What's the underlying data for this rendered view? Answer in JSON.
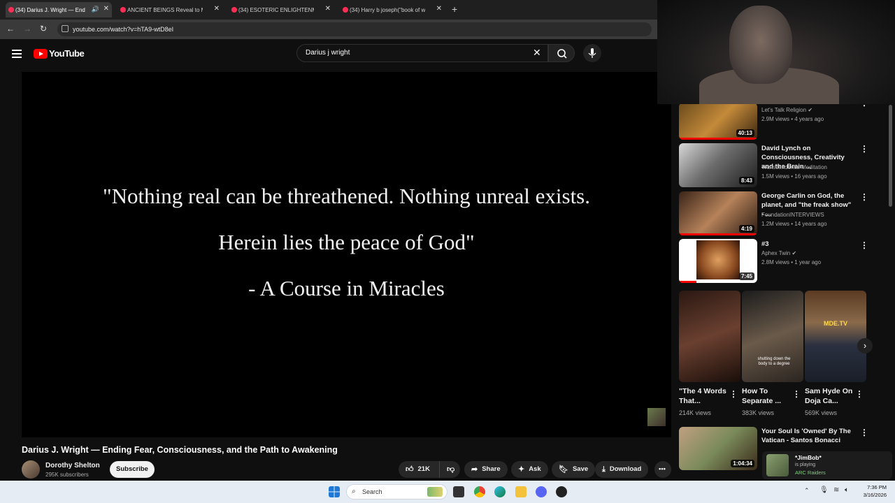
{
  "browser": {
    "tabs": [
      {
        "label": "(34) Darius J. Wright — End",
        "active": true,
        "audio": true
      },
      {
        "label": "ANCIENT BEINGS Reveal to Ma",
        "active": false
      },
      {
        "label": "(34) ESOTERIC ENLIGHTENMEN",
        "active": false
      },
      {
        "label": "(34) Harry b joseph(\"book of wi",
        "active": false
      }
    ],
    "new_tab": "+",
    "url": "youtube.com/watch?v=hTA9-wtD8eI"
  },
  "youtube": {
    "logo_text": "YouTube",
    "search_value": "Darius j wright"
  },
  "video": {
    "quote_lines": [
      "\"Nothing real can be threathened. Nothing unreal exists.",
      "Herein lies the peace of God\"",
      "- A Course in Miracles"
    ],
    "title": "Darius J. Wright — Ending Fear, Consciousness, and the Path to Awakening",
    "channel": "Dorothy Shelton",
    "subscribers": "295K subscribers",
    "subscribe_label": "Subscribe",
    "likes": "21K",
    "share_label": "Share",
    "ask_label": "Ask",
    "save_label": "Save",
    "download_label": "Download"
  },
  "sidebar": {
    "videos": [
      {
        "title": "",
        "channel": "Let's Talk Religion",
        "verified": true,
        "meta": "2.9M views • 4 years ago",
        "duration": "40:13"
      },
      {
        "title": "David Lynch on Consciousness, Creativity and the Brain ...",
        "channel": "Transcendental Meditation",
        "verified": false,
        "meta": "1.5M views • 16 years ago",
        "duration": "8:43"
      },
      {
        "title": "George Carlin on God, the planet, and \"the freak show\" - ...",
        "channel": "FoundationINTERVIEWS",
        "verified": false,
        "meta": "1.2M views • 14 years ago",
        "duration": "4:19"
      },
      {
        "title": "#3",
        "channel": "Aphex Twin",
        "verified": true,
        "meta": "2.8M views • 1 year ago",
        "duration": "7:45"
      },
      {
        "title": "Your Soul Is 'Owned' By The Vatican - Santos Bonacci",
        "channel": "",
        "verified": false,
        "meta": "",
        "duration": "1:04:34"
      }
    ],
    "shorts": [
      {
        "title": "\"The 4 Words That...",
        "views": "214K views",
        "overlay": ""
      },
      {
        "title": "How To Separate ...",
        "views": "383K views",
        "overlay": "shutting down the body to a degree"
      },
      {
        "title": "Sam Hyde On Doja Ca...",
        "views": "569K views",
        "overlay": "MDE.TV"
      }
    ]
  },
  "notification": {
    "name": "*JimBob*",
    "status": "is playing",
    "game": "ARC Raiders"
  },
  "taskbar": {
    "search_placeholder": "Search",
    "time": "7:36 PM",
    "date": "3/16/2026"
  },
  "colors": {
    "yt_red": "#ff0000",
    "bg": "#0f0f0f",
    "taskbar": "#e6ecf4"
  }
}
